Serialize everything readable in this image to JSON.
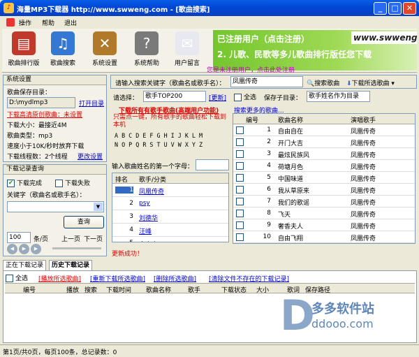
{
  "window": {
    "title": "海量MP3下载器   http://www.swweng.com - [歌曲搜索]"
  },
  "menu": [
    "操作",
    "帮助",
    "退出"
  ],
  "toolbar": [
    {
      "label": "歌曲排行版",
      "icon": "book-icon",
      "color": "#c0392b",
      "glyph": "▤"
    },
    {
      "label": "歌曲搜索",
      "icon": "music-notes-icon",
      "color": "#3478d4",
      "glyph": "♫"
    },
    {
      "label": "系统设置",
      "icon": "tools-icon",
      "color": "#b07a2a",
      "glyph": "✕"
    },
    {
      "label": "系统帮助",
      "icon": "help-robot-icon",
      "color": "#7a7a7a",
      "glyph": "?"
    },
    {
      "label": "用户留言",
      "icon": "note-icon",
      "color": "#e8e8f0",
      "glyph": "✉"
    }
  ],
  "banner": {
    "line1": "已注册用户（点击注册）",
    "line2": "2. 儿歌、民歌等多儿歌曲排行版任您下载",
    "site": "www.swweng"
  },
  "register_notice": "您是未注册用户，点击此处注册",
  "settings": {
    "header": "系统设置",
    "save_dir_label": "歌曲保存目录：",
    "save_dir": "D:\\mydlmp3",
    "open_dir": "打开目录",
    "hq_label": "下载高清原创歌曲：未设置",
    "size_label": "下载大小：最接近4M",
    "type_label": "歌曲类型：mp3",
    "speed_label": "速度小于10K/秒时放弃下载",
    "threads_label": "下载线程数：2个线程",
    "change_settings": "更改设置"
  },
  "history_query": {
    "header": "下载记录查询",
    "done": "下载完成",
    "failed": "下载失败",
    "keyword_label": "关键字（歌曲名或歌手名）：",
    "query": "查询",
    "page_size": "100",
    "per_page": "条/页",
    "prev": "上一页",
    "next": "下一页"
  },
  "search": {
    "label": "请输入搜索关键字（歌曲名或歌手名）：",
    "value": "凤凰传奇",
    "search_btn": "搜索歌曲",
    "download_btn": "下载所选歌曲"
  },
  "choose": {
    "label": "请选择：",
    "value": "歌手TOP200",
    "update": "[更新]"
  },
  "notes": {
    "all_line": "下载所有有歌手歌曲(高端用户功能)",
    "all_desc": "只需点一键，所有歌手的歌曲轻松下载到本机",
    "more": "搜索更多的歌曲..."
  },
  "alphabet": {
    "row1": "A B C D E F G H I J K L M",
    "row2": "N O P Q R S T U V W X Y Z",
    "prompt": "输入歌曲姓名的第一个字母："
  },
  "singers": {
    "headers": [
      "排名",
      "歌手/分类"
    ],
    "rows": [
      {
        "rank": "1",
        "name": "凤凰传奇"
      },
      {
        "rank": "2",
        "name": "psy"
      },
      {
        "rank": "3",
        "name": "刘德华"
      },
      {
        "rank": "4",
        "name": "汪峰"
      },
      {
        "rank": "5",
        "name": "金志文"
      }
    ]
  },
  "song_panel": {
    "select_all": "全选",
    "save_dir_label": "保存子目录：",
    "save_dir_value": "歌手姓名作为目录"
  },
  "songs": {
    "headers": [
      "编号",
      "歌曲名称",
      "演唱歌手"
    ],
    "rows": [
      {
        "no": "1",
        "title": "自由自在",
        "artist": "凤凰传奇"
      },
      {
        "no": "2",
        "title": "开门大吉",
        "artist": "凤凰传奇"
      },
      {
        "no": "3",
        "title": "最炫民族风",
        "artist": "凤凰传奇"
      },
      {
        "no": "4",
        "title": "荷塘月色",
        "artist": "凤凰传奇"
      },
      {
        "no": "5",
        "title": "中国味道",
        "artist": "凤凰传奇"
      },
      {
        "no": "6",
        "title": "我从草原来",
        "artist": "凤凰传奇"
      },
      {
        "no": "7",
        "title": "我们的歌谣",
        "artist": "凤凰传奇"
      },
      {
        "no": "8",
        "title": "飞天",
        "artist": "凤凰传奇"
      },
      {
        "no": "9",
        "title": "奢香夫人",
        "artist": "凤凰传奇"
      },
      {
        "no": "10",
        "title": "自由飞翔",
        "artist": "凤凰传奇"
      }
    ]
  },
  "status_msg": "更新成功！",
  "download_tabs": [
    "正在下载记录",
    "历史下载记录"
  ],
  "download_actions": {
    "select_all": "全选",
    "delete_selected": "[播放所选歌曲]",
    "redownload": "[重新下载所选歌曲]",
    "delete_records": "[删除所选歌曲]",
    "clear_missing": "[清除文件不存在的下载记录]"
  },
  "download_headers": [
    "编号",
    "播放",
    "搜索",
    "下载时间",
    "歌曲名称",
    "歌手",
    "下载状态",
    "大小",
    "歌词",
    "保存路径"
  ],
  "watermark": {
    "cn": "多多软件站",
    "url": "ddooo.com"
  },
  "statusbar": "第1页/共0页，每页100条，总记录数：0",
  "colors": {
    "accent": "#0046d5",
    "banner": "#74c62e",
    "link": "#0000cc",
    "warn": "#e00000"
  }
}
